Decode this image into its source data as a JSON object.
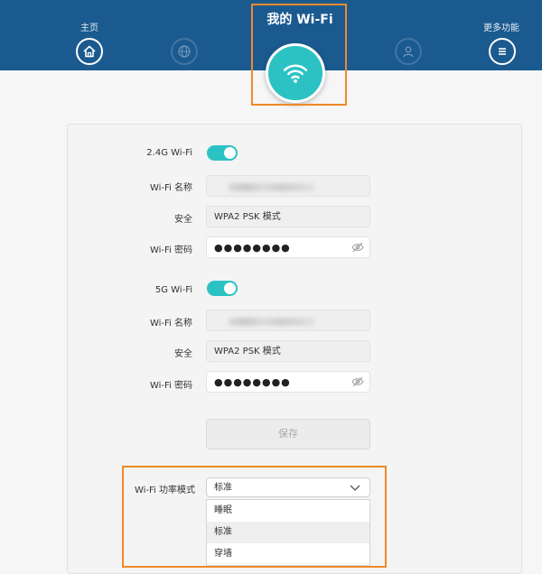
{
  "header": {
    "home_label": "主页",
    "more_label": "更多功能",
    "title": "我的 Wi-Fi"
  },
  "wifi24": {
    "section_label": "2.4G Wi-Fi",
    "enabled": true,
    "name_label": "Wi-Fi 名称",
    "security_label": "安全",
    "security_value": "WPA2 PSK 模式",
    "password_label": "Wi-Fi 密码",
    "password_value": "●●●●●●●●"
  },
  "wifi5": {
    "section_label": "5G Wi-Fi",
    "enabled": true,
    "name_label": "Wi-Fi 名称",
    "security_label": "安全",
    "security_value": "WPA2 PSK 模式",
    "password_label": "Wi-Fi 密码",
    "password_value": "●●●●●●●●"
  },
  "save_label": "保存",
  "power_mode": {
    "label": "Wi-Fi 功率模式",
    "selected": "标准",
    "options": [
      "睡眠",
      "标准",
      "穿墙"
    ]
  },
  "colors": {
    "header": "#1b5a8f",
    "accent": "#2cc2c4",
    "highlight_box": "#ef8a2a"
  },
  "icons": [
    "home-icon",
    "globe-icon",
    "wifi-icon",
    "user-icon",
    "menu-icon",
    "eye-off-icon",
    "chevron-down-icon"
  ]
}
